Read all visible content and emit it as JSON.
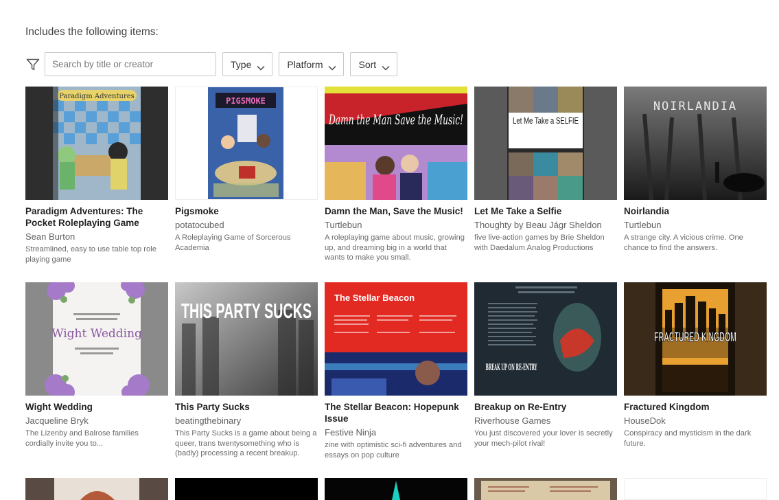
{
  "heading": "Includes the following items:",
  "search": {
    "placeholder": "Search by title or creator"
  },
  "filters": [
    {
      "label": "Type",
      "name": "type-dropdown"
    },
    {
      "label": "Platform",
      "name": "platform-dropdown"
    },
    {
      "label": "Sort",
      "name": "sort-dropdown"
    }
  ],
  "items": [
    {
      "title": "Paradigm Adventures: The Pocket Roleplaying Game",
      "author": "Sean Burton",
      "desc": "Streamlined, easy to use table top role playing game",
      "cover_text": "Paradigm Adventures"
    },
    {
      "title": "Pigsmoke",
      "author": "potatocubed",
      "desc": "A Roleplaying Game of Sorcerous Academia",
      "cover_text": "PIGSMOKE"
    },
    {
      "title": "Damn the Man, Save the Music!",
      "author": "Turtlebun",
      "desc": "A roleplaying game about music, growing up, and dreaming big in a world that wants to make you small.",
      "cover_text": "Damn the Man Save the Music!"
    },
    {
      "title": "Let Me Take a Selfie",
      "author": "Thoughty by Beau Jágr Sheldon",
      "desc": "five live-action games by Brie Sheldon with Daedalum Analog Productions",
      "cover_text": "Let Me Take a SELFIE"
    },
    {
      "title": "Noirlandia",
      "author": "Turtlebun",
      "desc": "A strange city. A vicious crime. One chance to find the answers.",
      "cover_text": "NOIRLANDIA"
    },
    {
      "title": "Wight Wedding",
      "author": "Jacqueline Bryk",
      "desc": "The Lizenby and Balrose families cordially invite you to...",
      "cover_text": "Wight Wedding"
    },
    {
      "title": "This Party Sucks",
      "author": "beatingthebinary",
      "desc": "This Party Sucks is a game about being a queer, trans twentysomething who is (badly) processing a recent breakup.",
      "cover_text": "THIS PARTY SUCKS"
    },
    {
      "title": "The Stellar Beacon: Hopepunk Issue",
      "author": "Festive Ninja",
      "desc": "zine with optimistic sci-fi adventures and essays on pop culture",
      "cover_text": "The Stellar Beacon"
    },
    {
      "title": "Breakup on Re-Entry",
      "author": "Riverhouse Games",
      "desc": "You just discovered your lover is secretly your mech-pilot rival!",
      "cover_text": "BREAK UP ON RE-ENTRY"
    },
    {
      "title": "Fractured Kingdom",
      "author": "HouseDok",
      "desc": "Conspiracy and mysticism in the dark future.",
      "cover_text": "FRACTURED KINGDOM"
    }
  ]
}
